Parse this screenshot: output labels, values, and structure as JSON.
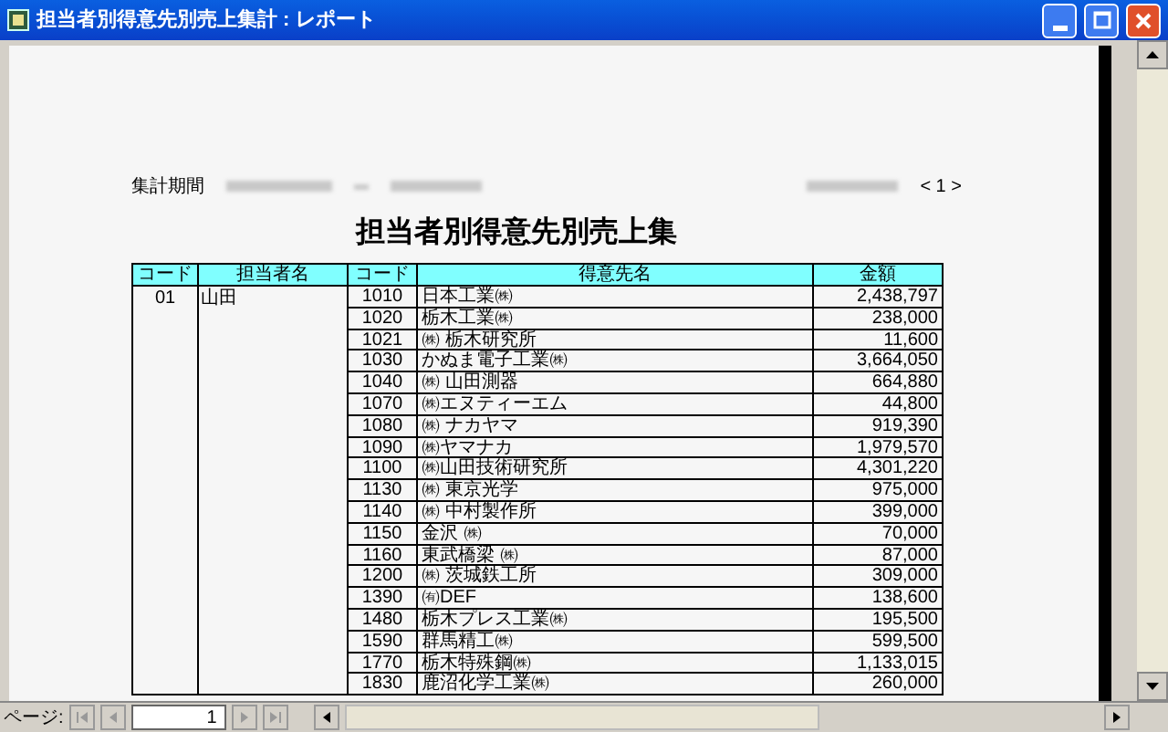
{
  "window": {
    "title": "担当者別得意先別売上集計 : レポート"
  },
  "report": {
    "period_label": "集計期間",
    "page_indicator": "< 1 >",
    "title": "担当者別得意先別売上集",
    "columns": [
      "コード",
      "担当者名",
      "コード",
      "得意先名",
      "金額"
    ],
    "groups": [
      {
        "code": "01",
        "name": "山田",
        "customers": [
          {
            "code": "1010",
            "name": "日本工業㈱",
            "amount": "2,438,797"
          },
          {
            "code": "1020",
            "name": "栃木工業㈱",
            "amount": "238,000"
          },
          {
            "code": "1021",
            "name": "㈱ 栃木研究所",
            "amount": "11,600"
          },
          {
            "code": "1030",
            "name": "かぬま電子工業㈱",
            "amount": "3,664,050"
          },
          {
            "code": "1040",
            "name": "㈱ 山田測器",
            "amount": "664,880"
          },
          {
            "code": "1070",
            "name": "㈱エヌティーエム",
            "amount": "44,800"
          },
          {
            "code": "1080",
            "name": "㈱ ナカヤマ",
            "amount": "919,390"
          },
          {
            "code": "1090",
            "name": "㈱ヤマナカ",
            "amount": "1,979,570"
          },
          {
            "code": "1100",
            "name": "㈱山田技術研究所",
            "amount": "4,301,220"
          },
          {
            "code": "1130",
            "name": "㈱ 東京光学",
            "amount": "975,000"
          },
          {
            "code": "1140",
            "name": "㈱ 中村製作所",
            "amount": "399,000"
          },
          {
            "code": "1150",
            "name": "金沢 ㈱",
            "amount": "70,000"
          },
          {
            "code": "1160",
            "name": "東武橋梁 ㈱",
            "amount": "87,000"
          },
          {
            "code": "1200",
            "name": "㈱ 茨城鉄工所",
            "amount": "309,000"
          },
          {
            "code": "1390",
            "name": "㈲DEF",
            "amount": "138,600"
          },
          {
            "code": "1480",
            "name": "栃木プレス工業㈱",
            "amount": "195,500"
          },
          {
            "code": "1590",
            "name": "群馬精工㈱",
            "amount": "599,500"
          },
          {
            "code": "1770",
            "name": "栃木特殊鋼㈱",
            "amount": "1,133,015"
          },
          {
            "code": "1830",
            "name": "鹿沼化学工業㈱",
            "amount": "260,000"
          }
        ]
      }
    ]
  },
  "navigation": {
    "label": "ページ:",
    "page": "1"
  }
}
